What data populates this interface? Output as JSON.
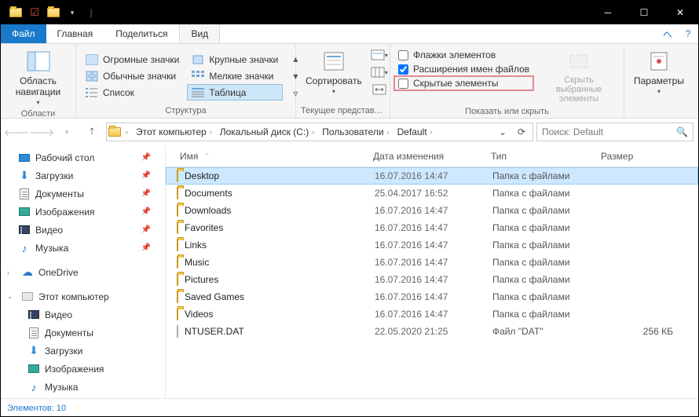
{
  "menubar": {
    "file": "Файл",
    "tabs": [
      "Главная",
      "Поделиться",
      "Вид"
    ],
    "active": 2
  },
  "ribbon": {
    "panes_label": "Области",
    "panes_btn": "Область навигации",
    "layout_label": "Структура",
    "layouts": [
      "Огромные значки",
      "Крупные значки",
      "Обычные значки",
      "Мелкие значки",
      "Список",
      "Таблица"
    ],
    "view_label": "Текущее представлен...",
    "sort_btn": "Сортировать",
    "show_label": "Показать или скрыть",
    "checks": {
      "item_checkboxes": "Флажки элементов",
      "file_ext": "Расширения имен файлов",
      "hidden_items": "Скрытые элементы"
    },
    "hide_btn": "Скрыть выбранные элементы",
    "options_btn": "Параметры"
  },
  "breadcrumbs": [
    "Этот компьютер",
    "Локальный диск (C:)",
    "Пользователи",
    "Default"
  ],
  "search_placeholder": "Поиск: Default",
  "nav": {
    "quick": [
      {
        "label": "Рабочий стол",
        "icon": "desktop"
      },
      {
        "label": "Загрузки",
        "icon": "download"
      },
      {
        "label": "Документы",
        "icon": "doc"
      },
      {
        "label": "Изображения",
        "icon": "img"
      },
      {
        "label": "Видео",
        "icon": "vid"
      },
      {
        "label": "Музыка",
        "icon": "music"
      }
    ],
    "onedrive": "OneDrive",
    "thispc": "Этот компьютер",
    "thispc_items": [
      {
        "label": "Видео",
        "icon": "vid"
      },
      {
        "label": "Документы",
        "icon": "doc"
      },
      {
        "label": "Загрузки",
        "icon": "download"
      },
      {
        "label": "Изображения",
        "icon": "img"
      },
      {
        "label": "Музыка",
        "icon": "music"
      }
    ]
  },
  "columns": {
    "name": "Имя",
    "date": "Дата изменения",
    "type": "Тип",
    "size": "Размер"
  },
  "files": [
    {
      "name": "Desktop",
      "date": "16.07.2016 14:47",
      "type": "Папка с файлами",
      "size": "",
      "kind": "folder",
      "sel": true
    },
    {
      "name": "Documents",
      "date": "25.04.2017 16:52",
      "type": "Папка с файлами",
      "size": "",
      "kind": "folder"
    },
    {
      "name": "Downloads",
      "date": "16.07.2016 14:47",
      "type": "Папка с файлами",
      "size": "",
      "kind": "folder"
    },
    {
      "name": "Favorites",
      "date": "16.07.2016 14:47",
      "type": "Папка с файлами",
      "size": "",
      "kind": "folder"
    },
    {
      "name": "Links",
      "date": "16.07.2016 14:47",
      "type": "Папка с файлами",
      "size": "",
      "kind": "folder"
    },
    {
      "name": "Music",
      "date": "16.07.2016 14:47",
      "type": "Папка с файлами",
      "size": "",
      "kind": "folder"
    },
    {
      "name": "Pictures",
      "date": "16.07.2016 14:47",
      "type": "Папка с файлами",
      "size": "",
      "kind": "folder"
    },
    {
      "name": "Saved Games",
      "date": "16.07.2016 14:47",
      "type": "Папка с файлами",
      "size": "",
      "kind": "folder"
    },
    {
      "name": "Videos",
      "date": "16.07.2016 14:47",
      "type": "Папка с файлами",
      "size": "",
      "kind": "folder"
    },
    {
      "name": "NTUSER.DAT",
      "date": "22.05.2020 21:25",
      "type": "Файл \"DAT\"",
      "size": "256 КБ",
      "kind": "file"
    }
  ],
  "status": "Элементов: 10"
}
